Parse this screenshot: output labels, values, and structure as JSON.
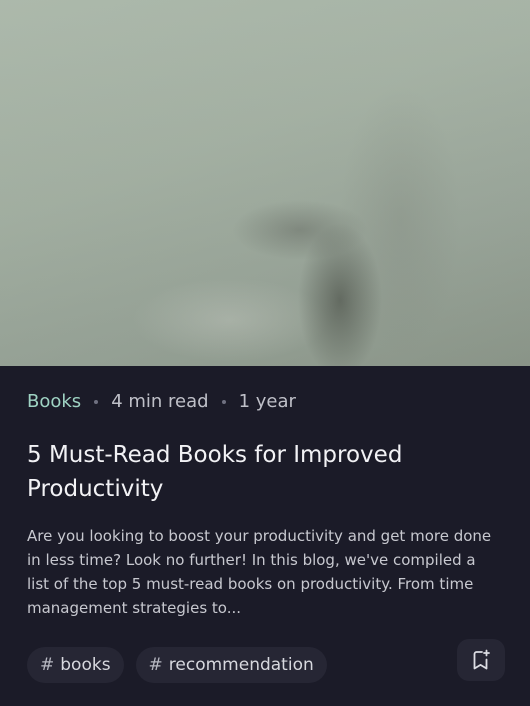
{
  "card": {
    "category": "Books",
    "read_time": "4 min read",
    "age": "1 year",
    "title": "5 Must-Read Books for Improved Productivity",
    "excerpt": "Are you looking to boost your productivity and get more done in less time? Look no further! In this blog, we've compiled a list of the top 5 must-read books on productivity. From time management strategies to...",
    "tags": [
      {
        "hash": "#",
        "label": "books"
      },
      {
        "hash": "#",
        "label": "recommendation"
      }
    ],
    "bookmark_icon": "bookmark-add-icon"
  },
  "colors": {
    "background": "#1b1b28",
    "category_accent": "#9fd3c3",
    "tag_background": "#262634"
  }
}
